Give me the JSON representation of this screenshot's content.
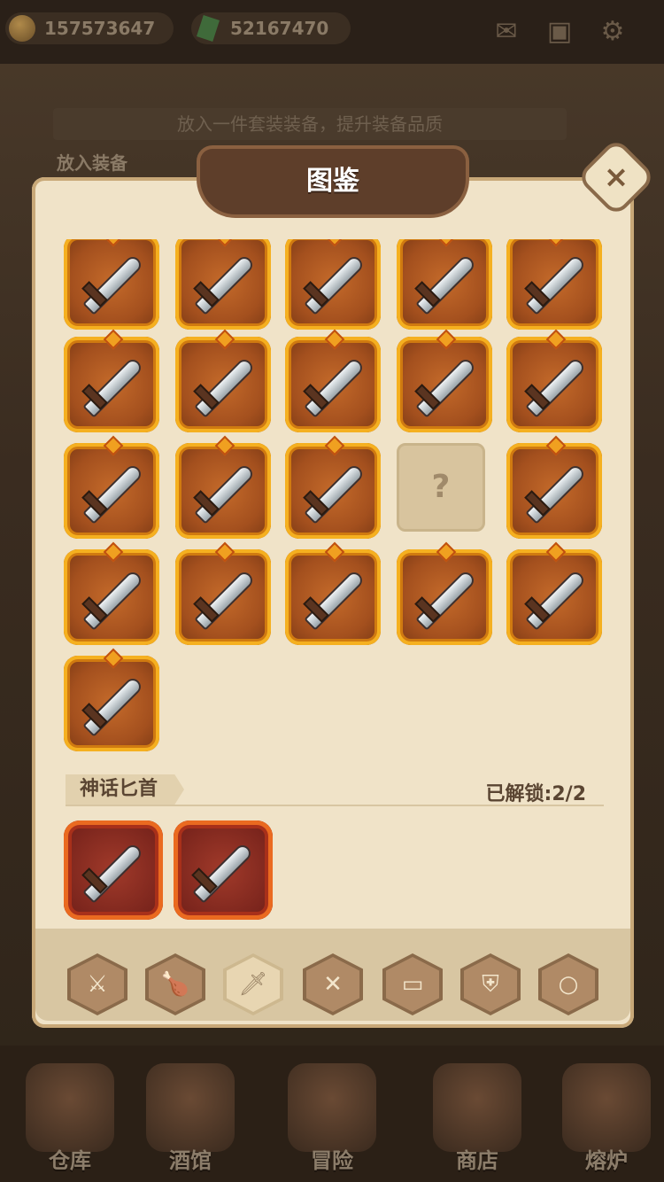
{
  "topbar": {
    "gold": "157573647",
    "gems": "52167470",
    "icons": [
      "mail-icon",
      "box-icon",
      "gear-icon"
    ]
  },
  "background": {
    "banner_text": "放入一件套装装备，提升装备品质",
    "label": "放入装备"
  },
  "modal": {
    "title": "图鉴",
    "close_symbol": "×",
    "section_label": "神话匕首",
    "unlock_text": "已解锁:2/2",
    "locked_symbol": "?",
    "grid": [
      [
        "item",
        "item",
        "item",
        "item",
        "item"
      ],
      [
        "item",
        "item",
        "item",
        "item",
        "item"
      ],
      [
        "item",
        "item",
        "item",
        "locked",
        "item"
      ],
      [
        "item",
        "item",
        "item",
        "item",
        "item"
      ],
      [
        "item"
      ]
    ],
    "mythic_count": 2
  },
  "tabs": [
    {
      "icon": "weapon-icon",
      "active": false
    },
    {
      "icon": "club-icon",
      "active": false
    },
    {
      "icon": "dagger-icon",
      "active": true
    },
    {
      "icon": "shield-icon",
      "active": false
    },
    {
      "icon": "book-icon",
      "active": false
    },
    {
      "icon": "armor-icon",
      "active": false
    },
    {
      "icon": "ring-icon",
      "active": false
    }
  ],
  "bottom_nav": [
    "仓库",
    "酒馆",
    "冒险",
    "商店",
    "熔炉"
  ]
}
